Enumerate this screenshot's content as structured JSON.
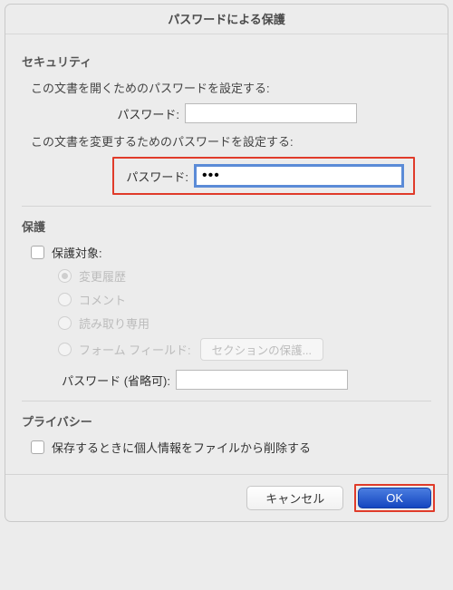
{
  "dialog": {
    "title": "パスワードによる保護"
  },
  "security": {
    "heading": "セキュリティ",
    "open_desc": "この文書を開くためのパスワードを設定する:",
    "open_pw_label": "パスワード:",
    "open_pw_value": "",
    "modify_desc": "この文書を変更するためのパスワードを設定する:",
    "modify_pw_label": "パスワード:",
    "modify_pw_value": "•••"
  },
  "protection": {
    "heading": "保護",
    "target_label": "保護対象:",
    "radios": {
      "changes": "変更履歴",
      "comments": "コメント",
      "readonly": "読み取り専用",
      "forms": "フォーム フィールド:"
    },
    "sections_btn": "セクションの保護...",
    "pw_optional_label": "パスワード (省略可):",
    "pw_optional_value": ""
  },
  "privacy": {
    "heading": "プライバシー",
    "remove_pi_label": "保存するときに個人情報をファイルから削除する"
  },
  "buttons": {
    "cancel": "キャンセル",
    "ok": "OK"
  }
}
